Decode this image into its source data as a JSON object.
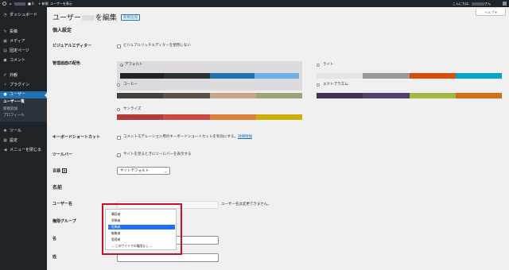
{
  "adminbar": {
    "new_label": "新規",
    "view_user": "ユーザーを表示",
    "greeting_prefix": "こんにちは、",
    "greeting_suffix": "さん"
  },
  "sidebar": {
    "items": [
      {
        "label": "ダッシュボード",
        "icon": "dashboard-icon"
      },
      {
        "label": "投稿",
        "icon": "pin-icon"
      },
      {
        "label": "メディア",
        "icon": "media-icon"
      },
      {
        "label": "固定ページ",
        "icon": "page-icon"
      },
      {
        "label": "コメント",
        "icon": "comment-icon"
      },
      {
        "label": "外観",
        "icon": "brush-icon"
      },
      {
        "label": "プラグイン",
        "icon": "plugin-icon"
      },
      {
        "label": "ユーザー",
        "icon": "users-icon"
      },
      {
        "label": "ツール",
        "icon": "wrench-icon"
      },
      {
        "label": "設定",
        "icon": "settings-icon"
      },
      {
        "label": "メニューを閉じる",
        "icon": "collapse-icon"
      }
    ],
    "submenu": [
      "ユーザー一覧",
      "新規追加",
      "プロフィール"
    ]
  },
  "page": {
    "title_prefix": "ユーザー",
    "title_suffix": "を編集",
    "new_button": "新規追加",
    "help": "ヘルプ ▾",
    "section_personal": "個人設定",
    "section_name": "名前"
  },
  "fields": {
    "visual_editor_label": "ビジュアルエディター",
    "visual_editor_text": "ビジュアルリッチエディターを使用しない",
    "color_scheme_label": "管理画面の配色",
    "keyboard_label": "キーボードショートカット",
    "keyboard_text": "コメントモデレーション用のキーボードショートカットを有効にする。",
    "keyboard_link": "詳細情報",
    "toolbar_label": "ツールバー",
    "toolbar_text": "サイトを見るときにツールバーを表示する",
    "language_label": "言語",
    "language_value": "サイトデフォルト",
    "username_label": "ユーザー名",
    "username_note": "ユーザー名は変更できません。",
    "role_label": "権限グループ",
    "first_name_label": "名",
    "last_name_label": "姓"
  },
  "color_schemes": [
    {
      "name": "デフォルト",
      "selected": true,
      "colors": [
        "#1d2327",
        "#2c3338",
        "#2271b1",
        "#72aee6"
      ]
    },
    {
      "name": "ライト",
      "selected": false,
      "colors": [
        "#e5e5e5",
        "#999999",
        "#d64e07",
        "#04a4cc"
      ]
    },
    {
      "name": "コーヒー",
      "selected": false,
      "colors": [
        "#46403c",
        "#59524c",
        "#c7a589",
        "#9ea476"
      ]
    },
    {
      "name": "エクトプラズム",
      "selected": false,
      "colors": [
        "#413256",
        "#523f6d",
        "#a3b745",
        "#d46f15"
      ]
    },
    {
      "name": "サンライズ",
      "selected": false,
      "colors": [
        "#b43c38",
        "#cf4944",
        "#dd823b",
        "#ccaf0b"
      ]
    }
  ],
  "role_options": [
    {
      "label": "購読者",
      "selected": false
    },
    {
      "label": "寄稿者",
      "selected": false
    },
    {
      "label": "投稿者",
      "selected": true
    },
    {
      "label": "編集者",
      "selected": false
    },
    {
      "label": "管理者",
      "selected": false
    },
    {
      "label": "— このサイトでの権限なし —",
      "selected": false
    }
  ],
  "colors": {
    "accent": "#2271b1",
    "sidebar": "#1d2327",
    "highlight_box": "#c8102e",
    "dropdown_selected": "#1e70ff"
  }
}
